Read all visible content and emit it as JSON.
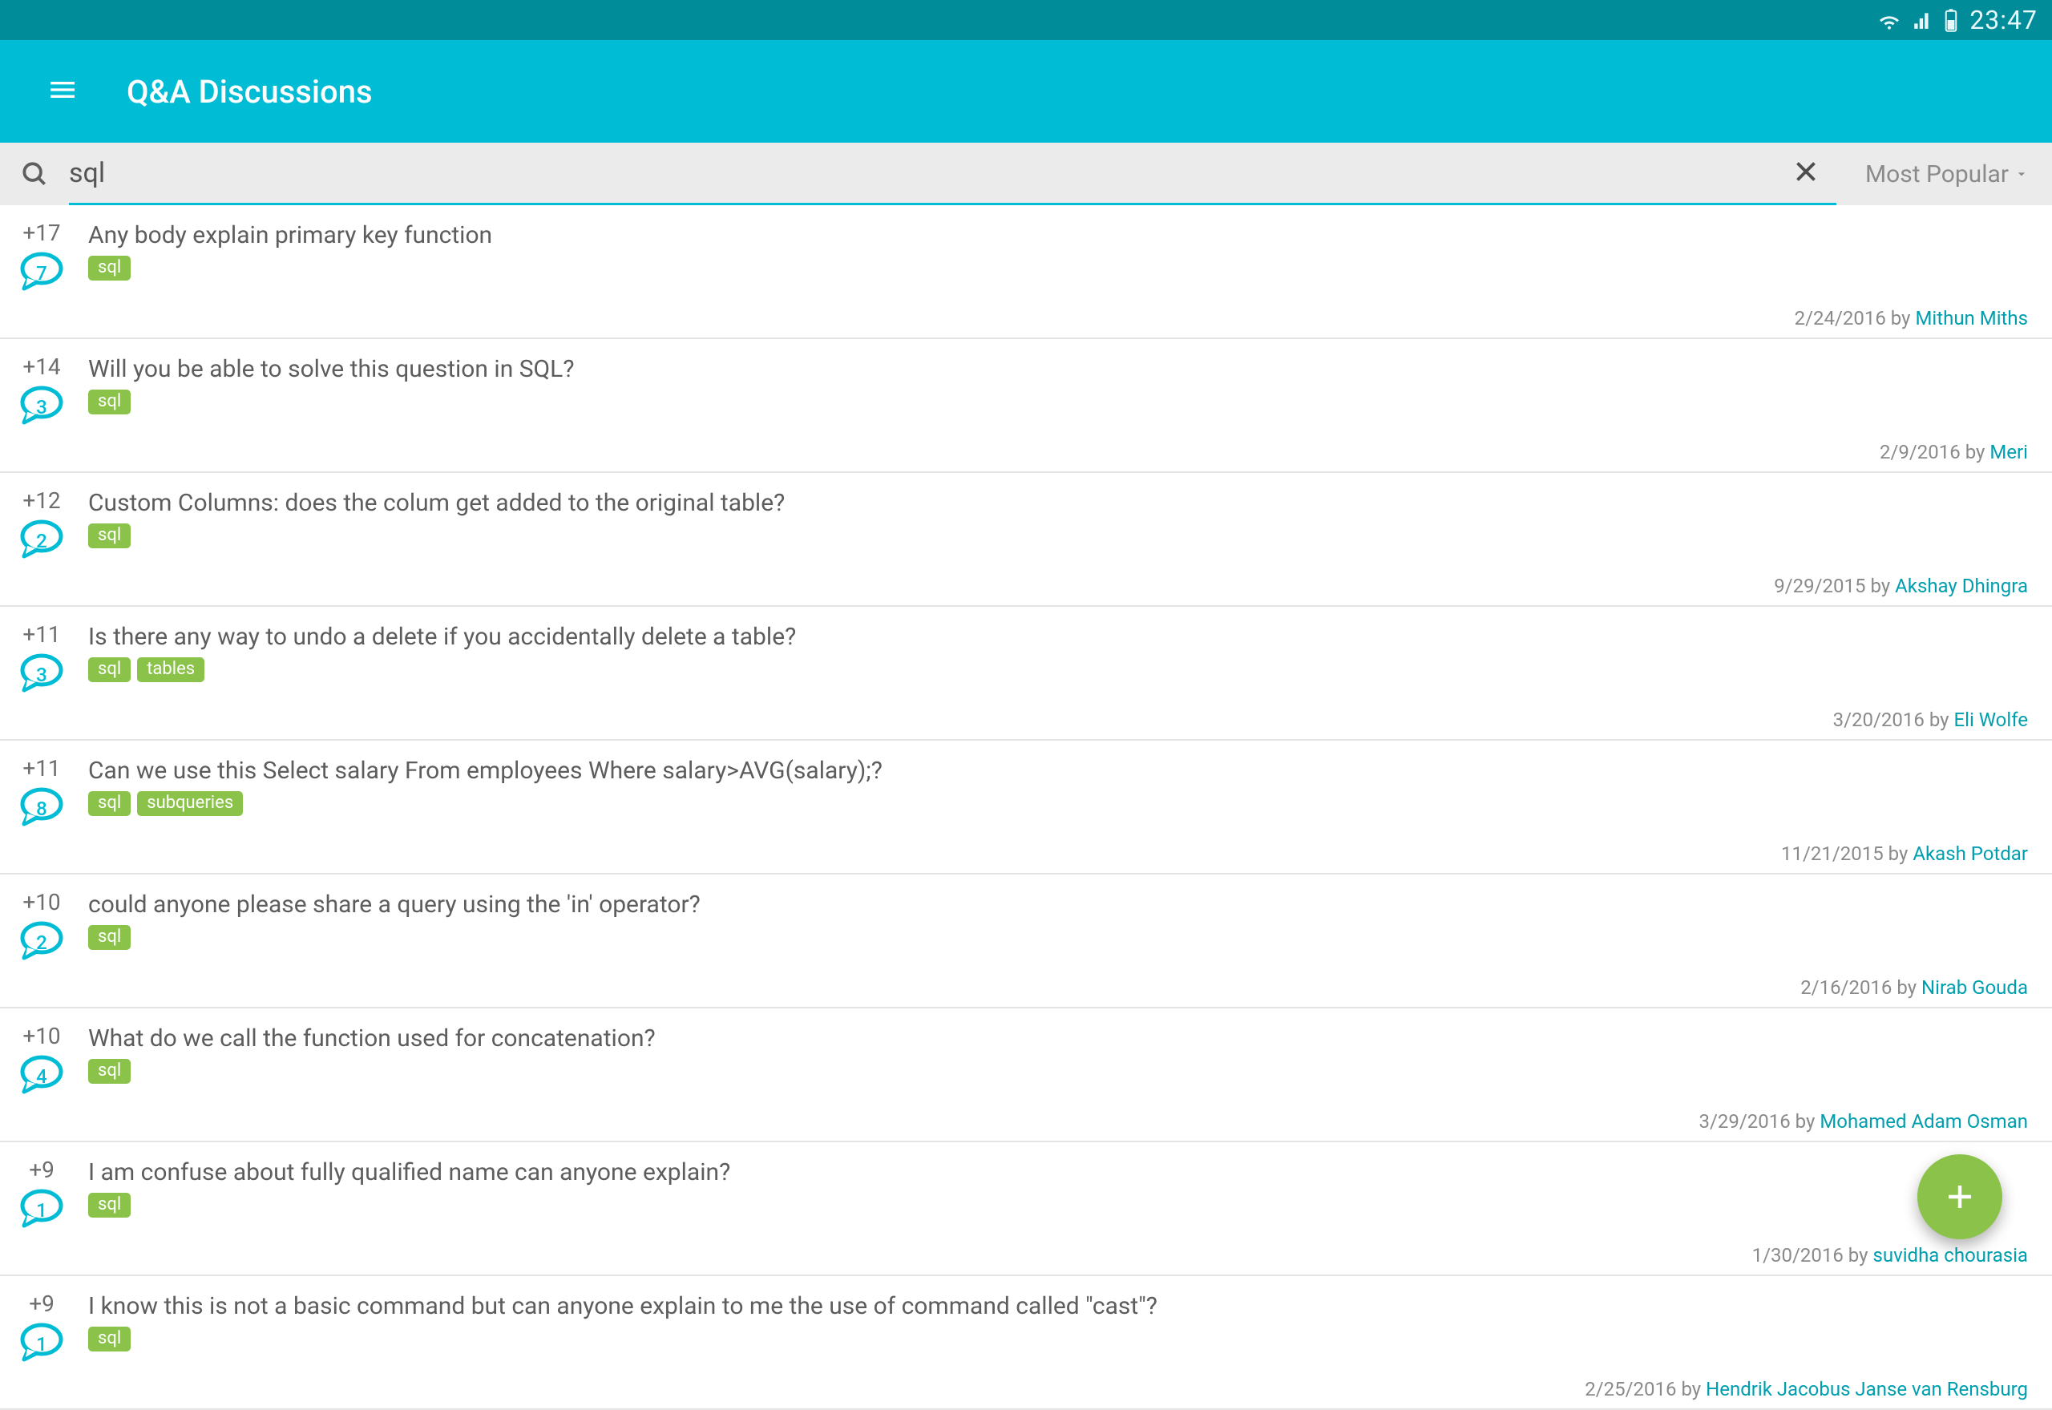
{
  "status_bar": {
    "time": "23:47"
  },
  "app_bar": {
    "title": "Q&A Discussions"
  },
  "search": {
    "value": "sql",
    "sort_label": "Most Popular"
  },
  "by_label": "by",
  "discussions": [
    {
      "votes": "+17",
      "comments": "7",
      "title": "Any body explain primary key function",
      "tags": [
        "sql"
      ],
      "date": "2/24/2016",
      "author": "Mithun Miths"
    },
    {
      "votes": "+14",
      "comments": "3",
      "title": "Will you be able to solve this question in SQL?",
      "tags": [
        "sql"
      ],
      "date": "2/9/2016",
      "author": "Meri"
    },
    {
      "votes": "+12",
      "comments": "2",
      "title": "Custom Columns: does the colum get added to the original table?",
      "tags": [
        "sql"
      ],
      "date": "9/29/2015",
      "author": "Akshay Dhingra"
    },
    {
      "votes": "+11",
      "comments": "3",
      "title": "Is there any way to undo a delete if you accidentally delete a table?",
      "tags": [
        "sql",
        "tables"
      ],
      "date": "3/20/2016",
      "author": "Eli Wolfe"
    },
    {
      "votes": "+11",
      "comments": "8",
      "title": "Can we use this Select salary From employees Where salary>AVG(salary);?",
      "tags": [
        "sql",
        "subqueries"
      ],
      "date": "11/21/2015",
      "author": "Akash Potdar"
    },
    {
      "votes": "+10",
      "comments": "2",
      "title": "could anyone please share a query using the 'in' operator?",
      "tags": [
        "sql"
      ],
      "date": "2/16/2016",
      "author": "Nirab Gouda"
    },
    {
      "votes": "+10",
      "comments": "4",
      "title": "What do we call the function used for concatenation?",
      "tags": [
        "sql"
      ],
      "date": "3/29/2016",
      "author": "Mohamed Adam Osman"
    },
    {
      "votes": "+9",
      "comments": "1",
      "title": "I am confuse about fully qualified name can anyone explain?",
      "tags": [
        "sql"
      ],
      "date": "1/30/2016",
      "author": "suvidha chourasia"
    },
    {
      "votes": "+9",
      "comments": "1",
      "title": "I know this is not a basic command but can anyone explain to me the use of command called \"cast\"?",
      "tags": [
        "sql"
      ],
      "date": "2/25/2016",
      "author": "Hendrik Jacobus Janse van Rensburg"
    }
  ]
}
